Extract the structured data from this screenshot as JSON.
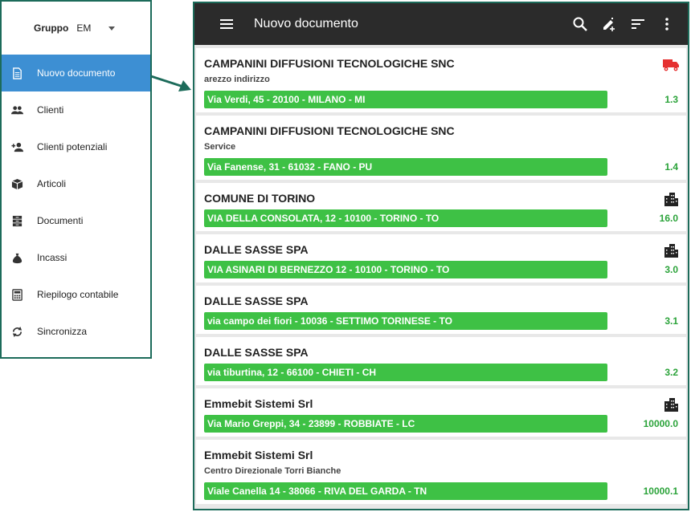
{
  "drawer": {
    "group_label": "Gruppo",
    "group_value": "EM",
    "items": [
      {
        "label": "Nuovo documento",
        "icon": "document-icon",
        "active": true
      },
      {
        "label": "Clienti",
        "icon": "people-icon"
      },
      {
        "label": "Clienti potenziali",
        "icon": "add-person-icon"
      },
      {
        "label": "Articoli",
        "icon": "box-icon"
      },
      {
        "label": "Documenti",
        "icon": "archive-icon"
      },
      {
        "label": "Incassi",
        "icon": "money-bag-icon"
      },
      {
        "label": "Riepilogo contabile",
        "icon": "calculator-icon"
      },
      {
        "label": "Sincronizza",
        "icon": "sync-icon"
      }
    ]
  },
  "appbar": {
    "title": "Nuovo documento"
  },
  "colors": {
    "appbar": "#2b2b2b",
    "active_item": "#3d8fd3",
    "address_bar": "#3ec145",
    "value_text": "#2ba33a",
    "truck": "#e53030",
    "frame": "#1c6b5a"
  },
  "customers": [
    {
      "name": "CAMPANINI DIFFUSIONI TECNOLOGICHE SNC",
      "sub": "arezzo indirizzo",
      "address": "Via Verdi, 45 - 20100 - MILANO - MI",
      "value": "1.3",
      "icon": "truck-icon"
    },
    {
      "name": "CAMPANINI DIFFUSIONI TECNOLOGICHE SNC",
      "sub": "Service",
      "address": "Via Fanense, 31 - 61032 - FANO - PU",
      "value": "1.4",
      "icon": ""
    },
    {
      "name": "COMUNE DI TORINO",
      "sub": "",
      "address": "VIA DELLA CONSOLATA, 12 - 10100 - TORINO - TO",
      "value": "16.0",
      "icon": "building-icon"
    },
    {
      "name": "DALLE SASSE SPA",
      "sub": "",
      "address": "VIA ASINARI DI BERNEZZO 12 - 10100 - TORINO - TO",
      "value": "3.0",
      "icon": "building-icon"
    },
    {
      "name": "DALLE SASSE SPA",
      "sub": "",
      "address": "via campo dei fiori - 10036 - SETTIMO TORINESE - TO",
      "value": "3.1",
      "icon": ""
    },
    {
      "name": "DALLE SASSE SPA",
      "sub": "",
      "address": "via tiburtina, 12 - 66100 - CHIETI - CH",
      "value": "3.2",
      "icon": ""
    },
    {
      "name": "Emmebit Sistemi Srl",
      "sub": "",
      "address": "Via Mario Greppi, 34 - 23899 - ROBBIATE - LC",
      "value": "10000.0",
      "icon": "building-icon"
    },
    {
      "name": "Emmebit Sistemi Srl",
      "sub": "Centro Direzionale Torri Bianche",
      "address": "Viale Canella 14 - 38066 - RIVA DEL GARDA - TN",
      "value": "10000.1",
      "icon": ""
    }
  ]
}
